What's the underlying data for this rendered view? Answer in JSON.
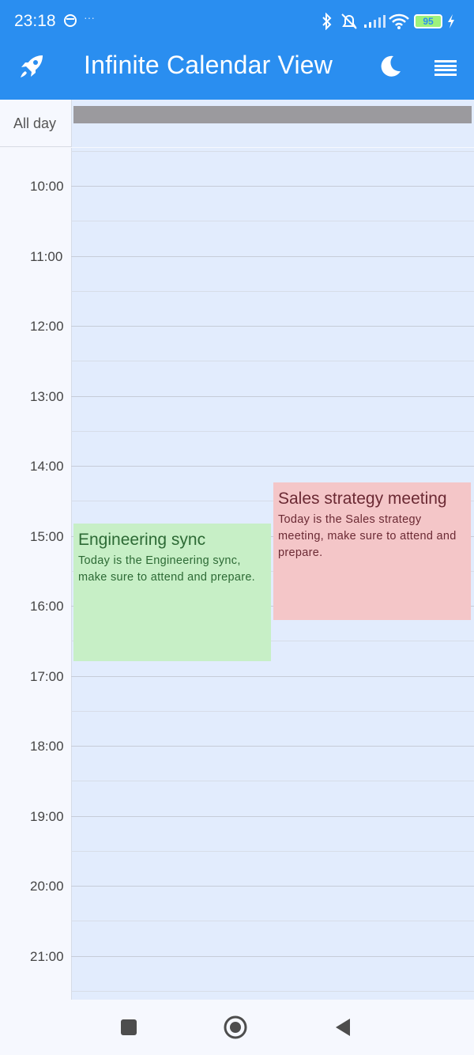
{
  "status_bar": {
    "time": "23:18",
    "battery": "95",
    "icons": [
      "notification-dot-icon",
      "bluetooth-icon",
      "mute-icon",
      "signal-icon",
      "wifi-icon",
      "battery-icon",
      "charging-icon"
    ]
  },
  "app_bar": {
    "title": "Infinite Calendar View",
    "leading_icon": "rocket-icon",
    "actions": [
      "moon-icon",
      "menu-icon"
    ]
  },
  "calendar": {
    "all_day_label": "All day",
    "hours": [
      "10:00",
      "11:00",
      "12:00",
      "13:00",
      "14:00",
      "15:00",
      "16:00",
      "17:00",
      "18:00",
      "19:00",
      "20:00",
      "21:00"
    ],
    "events": [
      {
        "title": "Engineering sync",
        "description": "Today is the Engineering sync, make sure to attend and prepare.",
        "color": "#c7efc6"
      },
      {
        "title": "Sales strategy meeting",
        "description": "Today is the Sales strategy meeting, make sure to attend and prepare.",
        "color": "#f4c6c8"
      }
    ]
  },
  "nav_bar": {
    "buttons": [
      "recents-square-icon",
      "home-circle-icon",
      "back-triangle-icon"
    ]
  },
  "colors": {
    "app_bar": "#2a8ef0",
    "day_column": "#e2ecfd",
    "all_day_event": "#9b9a9e"
  }
}
